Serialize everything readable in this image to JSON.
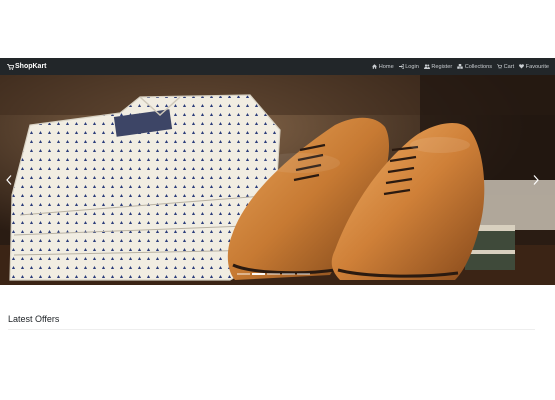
{
  "navbar": {
    "brand": "ShopKart",
    "links": [
      {
        "label": "Home",
        "icon": "home-icon"
      },
      {
        "label": "Login",
        "icon": "login-icon"
      },
      {
        "label": "Register",
        "icon": "register-icon"
      },
      {
        "label": "Collections",
        "icon": "collections-icon"
      },
      {
        "label": "Cart",
        "icon": "cart-icon"
      },
      {
        "label": "Favourite",
        "icon": "heart-icon"
      }
    ]
  },
  "carousel": {
    "slide_count": 5,
    "active_slide": 2,
    "image_subject": "folded patterned shirts beside brown leather oxford shoes"
  },
  "sections": {
    "latest_offers_title": "Latest Offers"
  },
  "colors": {
    "navbar_bg": "#222629",
    "nav_text": "#c9cdd1",
    "brand_text": "#ffffff"
  }
}
